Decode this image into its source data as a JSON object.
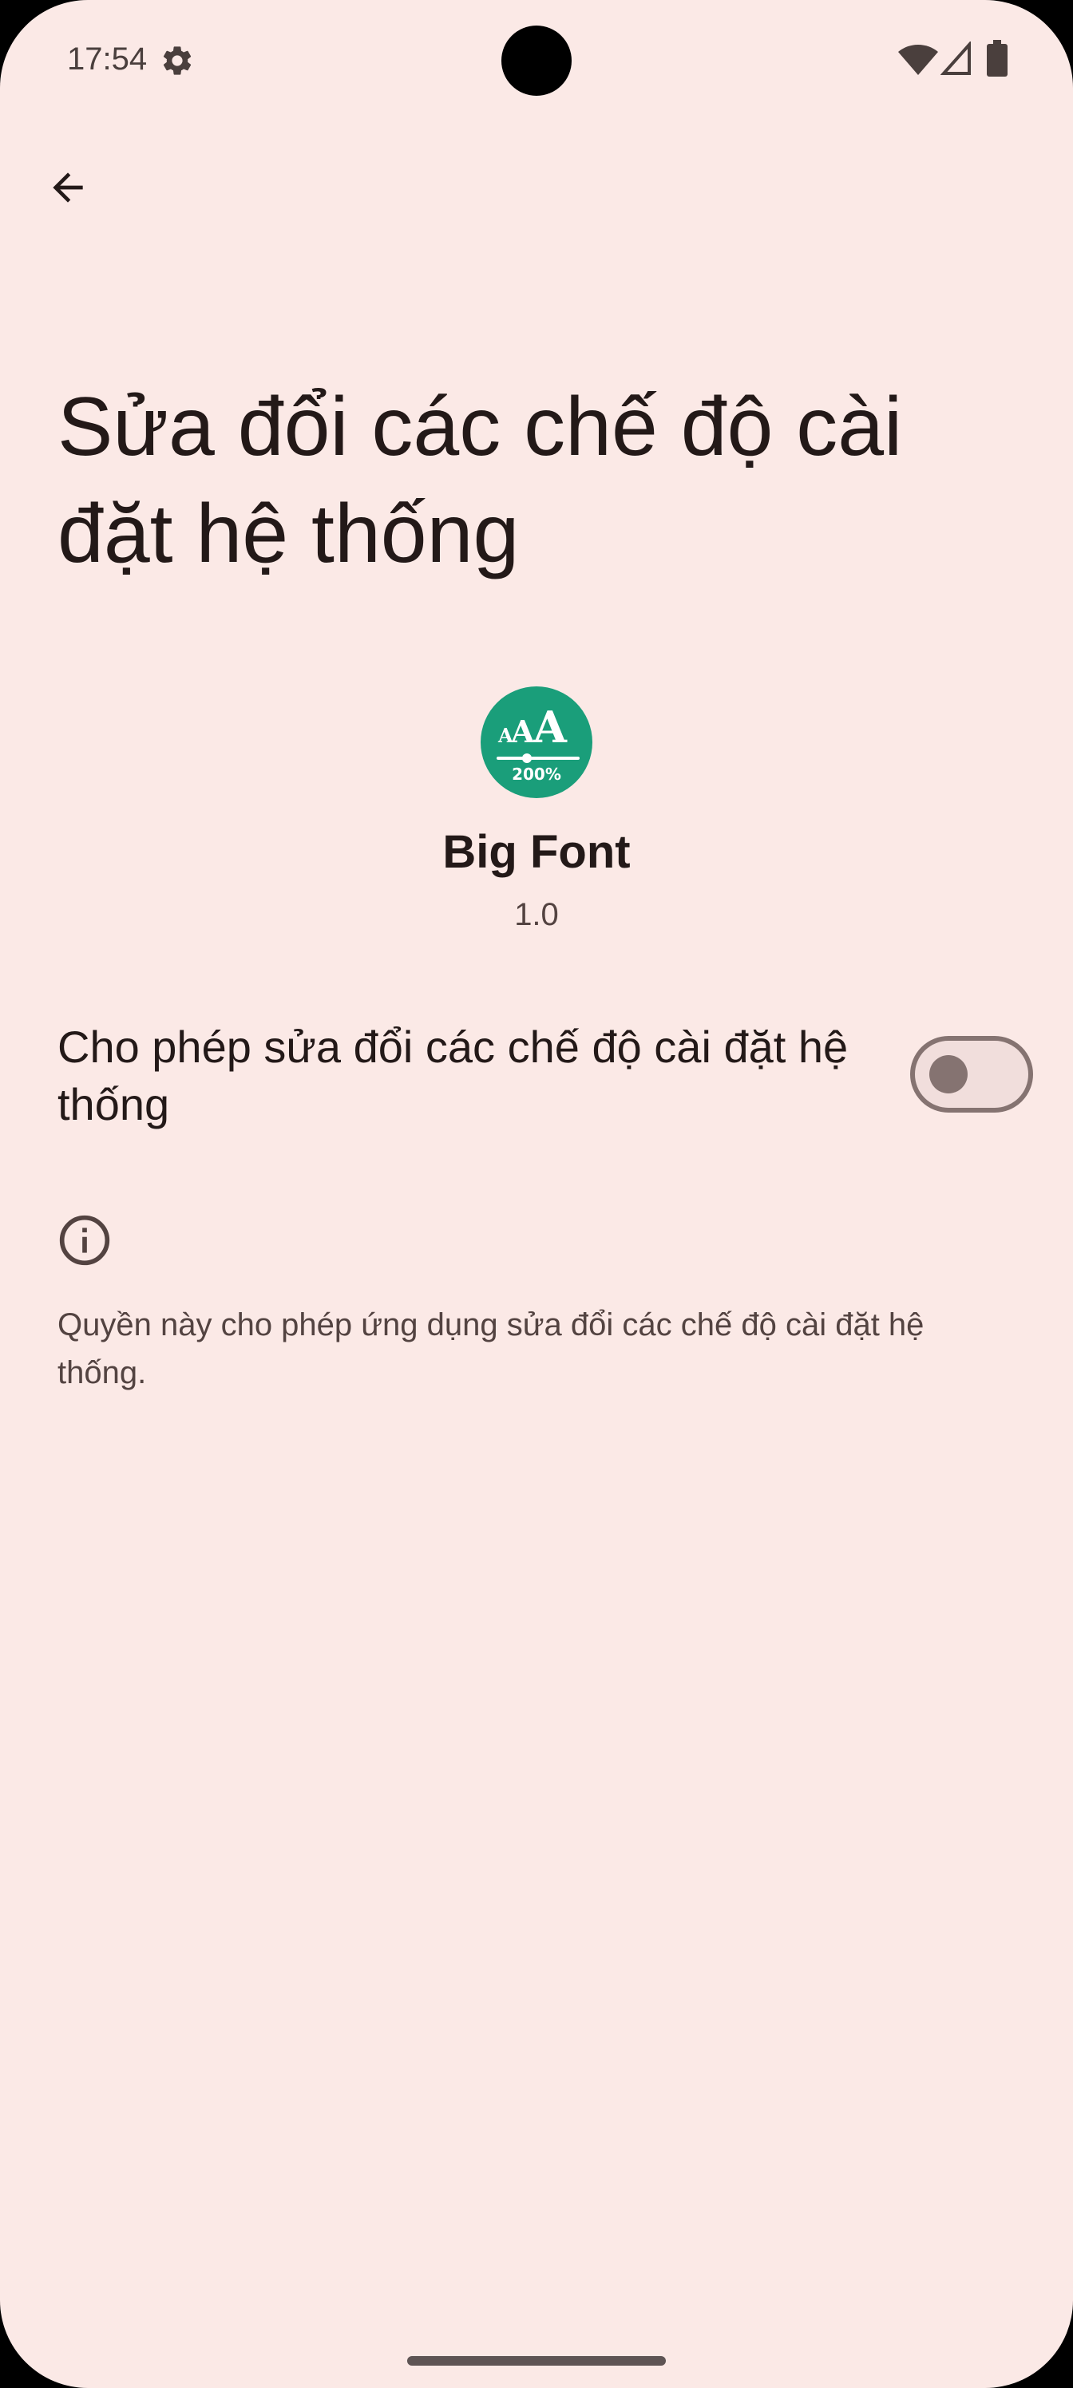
{
  "status_bar": {
    "time": "17:54",
    "icons": [
      "settings-gear-icon",
      "wifi-icon",
      "cell-signal-icon",
      "battery-icon"
    ]
  },
  "header": {
    "back_icon": "arrow-back-icon",
    "title": "Sửa đổi các chế độ cài đặt hệ thống"
  },
  "app": {
    "icon": "big-font-app-icon",
    "icon_text_small": "A",
    "icon_text_mid": "A",
    "icon_text_large": "A",
    "icon_percent": "200%",
    "name": "Big Font",
    "version": "1.0"
  },
  "setting": {
    "label": "Cho phép sửa đổi các chế độ cài đặt hệ thống",
    "enabled": false
  },
  "info": {
    "icon": "info-icon",
    "text": "Quyền này cho phép ứng dụng sửa đổi các chế độ cài đặt hệ thống."
  },
  "colors": {
    "background": "#fbe9e6",
    "app_icon_green": "#1a9e7a",
    "text_primary": "#231918",
    "text_secondary": "#534341",
    "toggle_outline": "#857371"
  }
}
